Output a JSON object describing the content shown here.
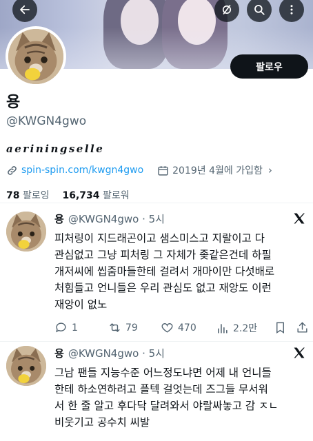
{
  "colors": {
    "link": "#1d9bf0",
    "text": "#0f1419",
    "muted": "#536471",
    "button_bg": "#0f1419"
  },
  "header": {
    "icons": [
      "back-arrow-icon",
      "circle-slash-icon",
      "search-icon",
      "more-vertical-icon"
    ]
  },
  "profile": {
    "follow_label": "팔로우",
    "display_name": "용",
    "handle": "@KWGN4gwo",
    "bio": "aeriningselle",
    "link": "spin-spin.com/kwgn4gwo",
    "joined": "2019년 4월에 가입함",
    "following_count": "78",
    "following_label": "팔로잉",
    "followers_count": "16,734",
    "followers_label": "팔로워"
  },
  "tweets": [
    {
      "name": "용",
      "handle_time": "@KWGN4gwo · 5시",
      "lines": [
        "피처링이 지드래곤이고 샘스미스고 지랄이고 다",
        "관심없고 그냥 피처링 그 자체가 좆같은건데 하필",
        "개저씨에 씹줌마들한테 걸려서 개마이만 다섯배로",
        "처힘들고 언니들은 우리 관심도 없고 재앙도 이런",
        "재앙이 없노"
      ],
      "actions": {
        "replies": "1",
        "retweets": "79",
        "likes": "470",
        "views": "2.2만"
      }
    },
    {
      "name": "용",
      "handle_time": "@KWGN4gwo · 5시",
      "lines": [
        "그남 팬들 지능수준 어느정도냐면 어제 내 언니들",
        "한테 하소연하려고 플텍 걸엇는데 즈그들 무서워",
        "서 한 줄 알고 후다닥 달려와서 야랄싸놓고 감 ㅈㄴ",
        "비웃기고 공수치 씨발"
      ]
    }
  ]
}
